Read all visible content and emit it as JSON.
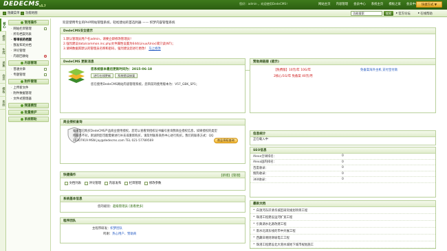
{
  "header": {
    "logo": "DEDECMS",
    "version": "v5.7",
    "user_info": "您好：admin ，欢迎使用DedeCMS！",
    "links": [
      "网站主页",
      "内容管理",
      "会员中心",
      "系统主页",
      "模板之家",
      "会员中心",
      "注销"
    ],
    "quick_button": "快捷方式 ▼"
  },
  "subbar": {
    "tab1": "隐藏菜单",
    "tab2": "功能地图",
    "search_value": "功能搜索",
    "search_button": "搜索",
    "link_feedback": "官方论坛",
    "link_help": "在线帮助"
  },
  "vtabs": [
    "核心",
    "模块",
    "生成",
    "采集",
    "会员",
    "模板",
    "系统"
  ],
  "sidebar": {
    "sections": [
      {
        "title": "常用操作",
        "items": [
          {
            "label": "网站栏目管理",
            "icon": "plus"
          },
          {
            "label": "所有档案列表",
            "icon": ""
          },
          {
            "label": "等审核的档案",
            "icon": ""
          },
          {
            "label": "我发布的文档",
            "icon": ""
          },
          {
            "label": "评论管理",
            "icon": ""
          },
          {
            "label": "内容回收站",
            "icon": "red"
          }
        ]
      },
      {
        "title": "内容管理",
        "items": [
          {
            "label": "普通文章",
            "icon": "plus"
          },
          {
            "label": "专题管理",
            "icon": "plus"
          }
        ]
      },
      {
        "title": "附件管理",
        "items": [
          {
            "label": "上传新文件",
            "icon": ""
          },
          {
            "label": "附件数据管理",
            "icon": ""
          },
          {
            "label": "文件式管理器",
            "icon": ""
          }
        ]
      },
      {
        "title": "频道模型",
        "items": []
      },
      {
        "title": "批量维护",
        "items": []
      },
      {
        "title": "系统帮助",
        "items": []
      }
    ]
  },
  "main": {
    "welcome": "欢迎使用专业的PHP网站管理系统，轻松建站的首选利器 —— 织梦内容管理系统",
    "security": {
      "title": "DedeCMS安全提示",
      "lines": [
        "1.默认管理员用户名admin，请要立即修改管理员！",
        "2.强烈建议data/common.inc.php文件属性设置为644(Linux/Unix)或只读(NT)；",
        "3.请将数据库默认的管理员名称和密码，强烈建议您进行更改！ "
      ],
      "link": "马上修改"
    },
    "update": {
      "title": "DedeCMS 更新消息",
      "version_line": "您系统版本最后更新时间为：2015-06-18",
      "btn_check": "进行在线更新",
      "btn_fix": "系统错误修复",
      "note": "您在使用DedeCMS网站内容管理系统，您目前的使用版本为：V57_GBK_SP1；"
    },
    "auth": {
      "title": "商业授权查询",
      "body": "如果您已购买DedeCMS产品商业使用授权，您可以查看到授权证书编号查询我商业授权信息，如果授权的类型所服务不对，则说明您可能需要进行补充或重新购买，请及时联系商务中心进行购买。我们的联系方式：QQ 10307919  MSN jay@dedecms.com  TEL 021-57789569",
      "button": "商业授权查询"
    },
    "quick": {
      "title": "快捷操作",
      "add": "【新增】",
      "manage": "【管理】",
      "items": [
        "文档列表",
        "评论管理",
        "内容发布",
        "栏目管理",
        "修改参数"
      ]
    },
    "sysinfo": {
      "title": "系统基本信息",
      "level_label": "您的级别：",
      "level_value": "超级管理员",
      "more": "[查看更多]"
    },
    "team": {
      "title": "程序团队",
      "leader_label": "主程序研发：",
      "leader_value": "织梦团队",
      "thanks_label": "鸣谢：",
      "thanks_value": "热心用户、赞助商"
    },
    "ads": {
      "title": "赞助商链接 (提示)",
      "red1": "【免费版】10元/年 10G/年",
      "blue1": "免备案海外主机  支付宝付款",
      "red2": "2核心/1G/年 免备案 40元/月"
    },
    "stats": {
      "title": "信息统计",
      "loading": "正在载入中"
    },
    "seo": {
      "title": "SEO信息",
      "rows": [
        {
          "label": "Alexa全球排名：",
          "value": "0"
        },
        {
          "label": "Alexa国内排名：",
          "value": "0"
        },
        {
          "label": "百度收录：",
          "value": "0"
        },
        {
          "label": "搜狗收录：",
          "value": "0"
        },
        {
          "label": "360收录：",
          "value": "0"
        }
      ]
    },
    "docs": {
      "title": "最新文档",
      "items": [
        "白须河东岸清华城区研究规划项目工程",
        "珠港工程建设运河扩宽工程",
        "引黄调水北源改建工程",
        "南水北调东线的市中开展工程",
        "西藏日喀则滑坡电工工程",
        "珠港工程建设北大港水城地下城市规划施工"
      ]
    }
  }
}
